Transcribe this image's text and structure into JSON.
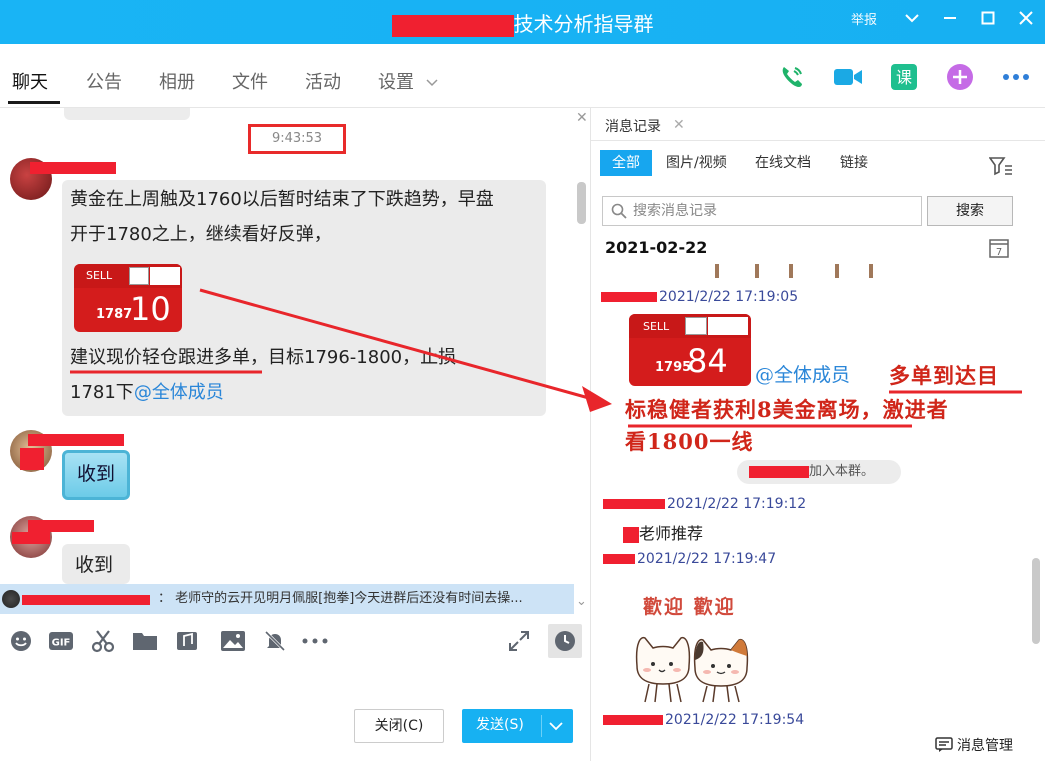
{
  "window": {
    "title": "技术分析指导群",
    "report_label": "举报"
  },
  "nav": {
    "tabs": [
      {
        "label": "聊天"
      },
      {
        "label": "公告"
      },
      {
        "label": "相册"
      },
      {
        "label": "文件"
      },
      {
        "label": "活动"
      },
      {
        "label": "设置"
      }
    ],
    "icons": [
      "phone-icon",
      "video-icon",
      "lesson-icon",
      "add-app-icon",
      "more-icon"
    ],
    "lesson_label": "课"
  },
  "chat": {
    "timestamp": "9:43:53",
    "message1": {
      "line1": "黄金在上周触及1760以后暂时结束了下跌趋势，早盘",
      "line2": "开于1780之上，继续看好反弹，",
      "line3": "建议现价轻仓跟进多单，目标1796-1800，止损",
      "line4_prefix": "1781下",
      "mention": "@全体成员",
      "ticket": {
        "sell": "SELL",
        "price_small": "1787",
        "price_big": "10"
      }
    },
    "sticker_text": "收到",
    "message3_text": "收到"
  },
  "notification": {
    "text": "： 老师守的云开见明月佩服[抱拳]今天进群后还没有时间去操..."
  },
  "toolbar": {
    "gif_label": "GIF",
    "close_label": "关闭(C)",
    "send_label": "发送(S)"
  },
  "history": {
    "tab_label": "消息记录",
    "filters": [
      "全部",
      "图片/视频",
      "在线文档",
      "链接"
    ],
    "search_placeholder": "搜索消息记录",
    "search_button": "搜索",
    "date": "2021-02-22",
    "calendar_day": "7",
    "entries": [
      {
        "time": "2021/2/22 17:19:05"
      },
      {
        "time": "2021/2/22 17:19:12"
      },
      {
        "time": "2021/2/22 17:19:47"
      },
      {
        "time": "2021/2/22 17:19:54"
      }
    ],
    "ticket": {
      "sell": "SELL",
      "price_small": "1795",
      "price_big": "84"
    },
    "mention": "@全体成员",
    "handwritten": {
      "line1": "多单到达目",
      "line2": "标稳健者获利8美金离场，激进者",
      "line3": "看1800一线"
    },
    "join_text": "加入本群。",
    "recommend_text": "老师推荐",
    "welcome_text": "歡迎 歡迎",
    "manage_label": "消息管理"
  },
  "colors": {
    "accent": "#17b1f2",
    "annotation_red": "#e8262b",
    "mention_blue": "#2a86d8"
  }
}
